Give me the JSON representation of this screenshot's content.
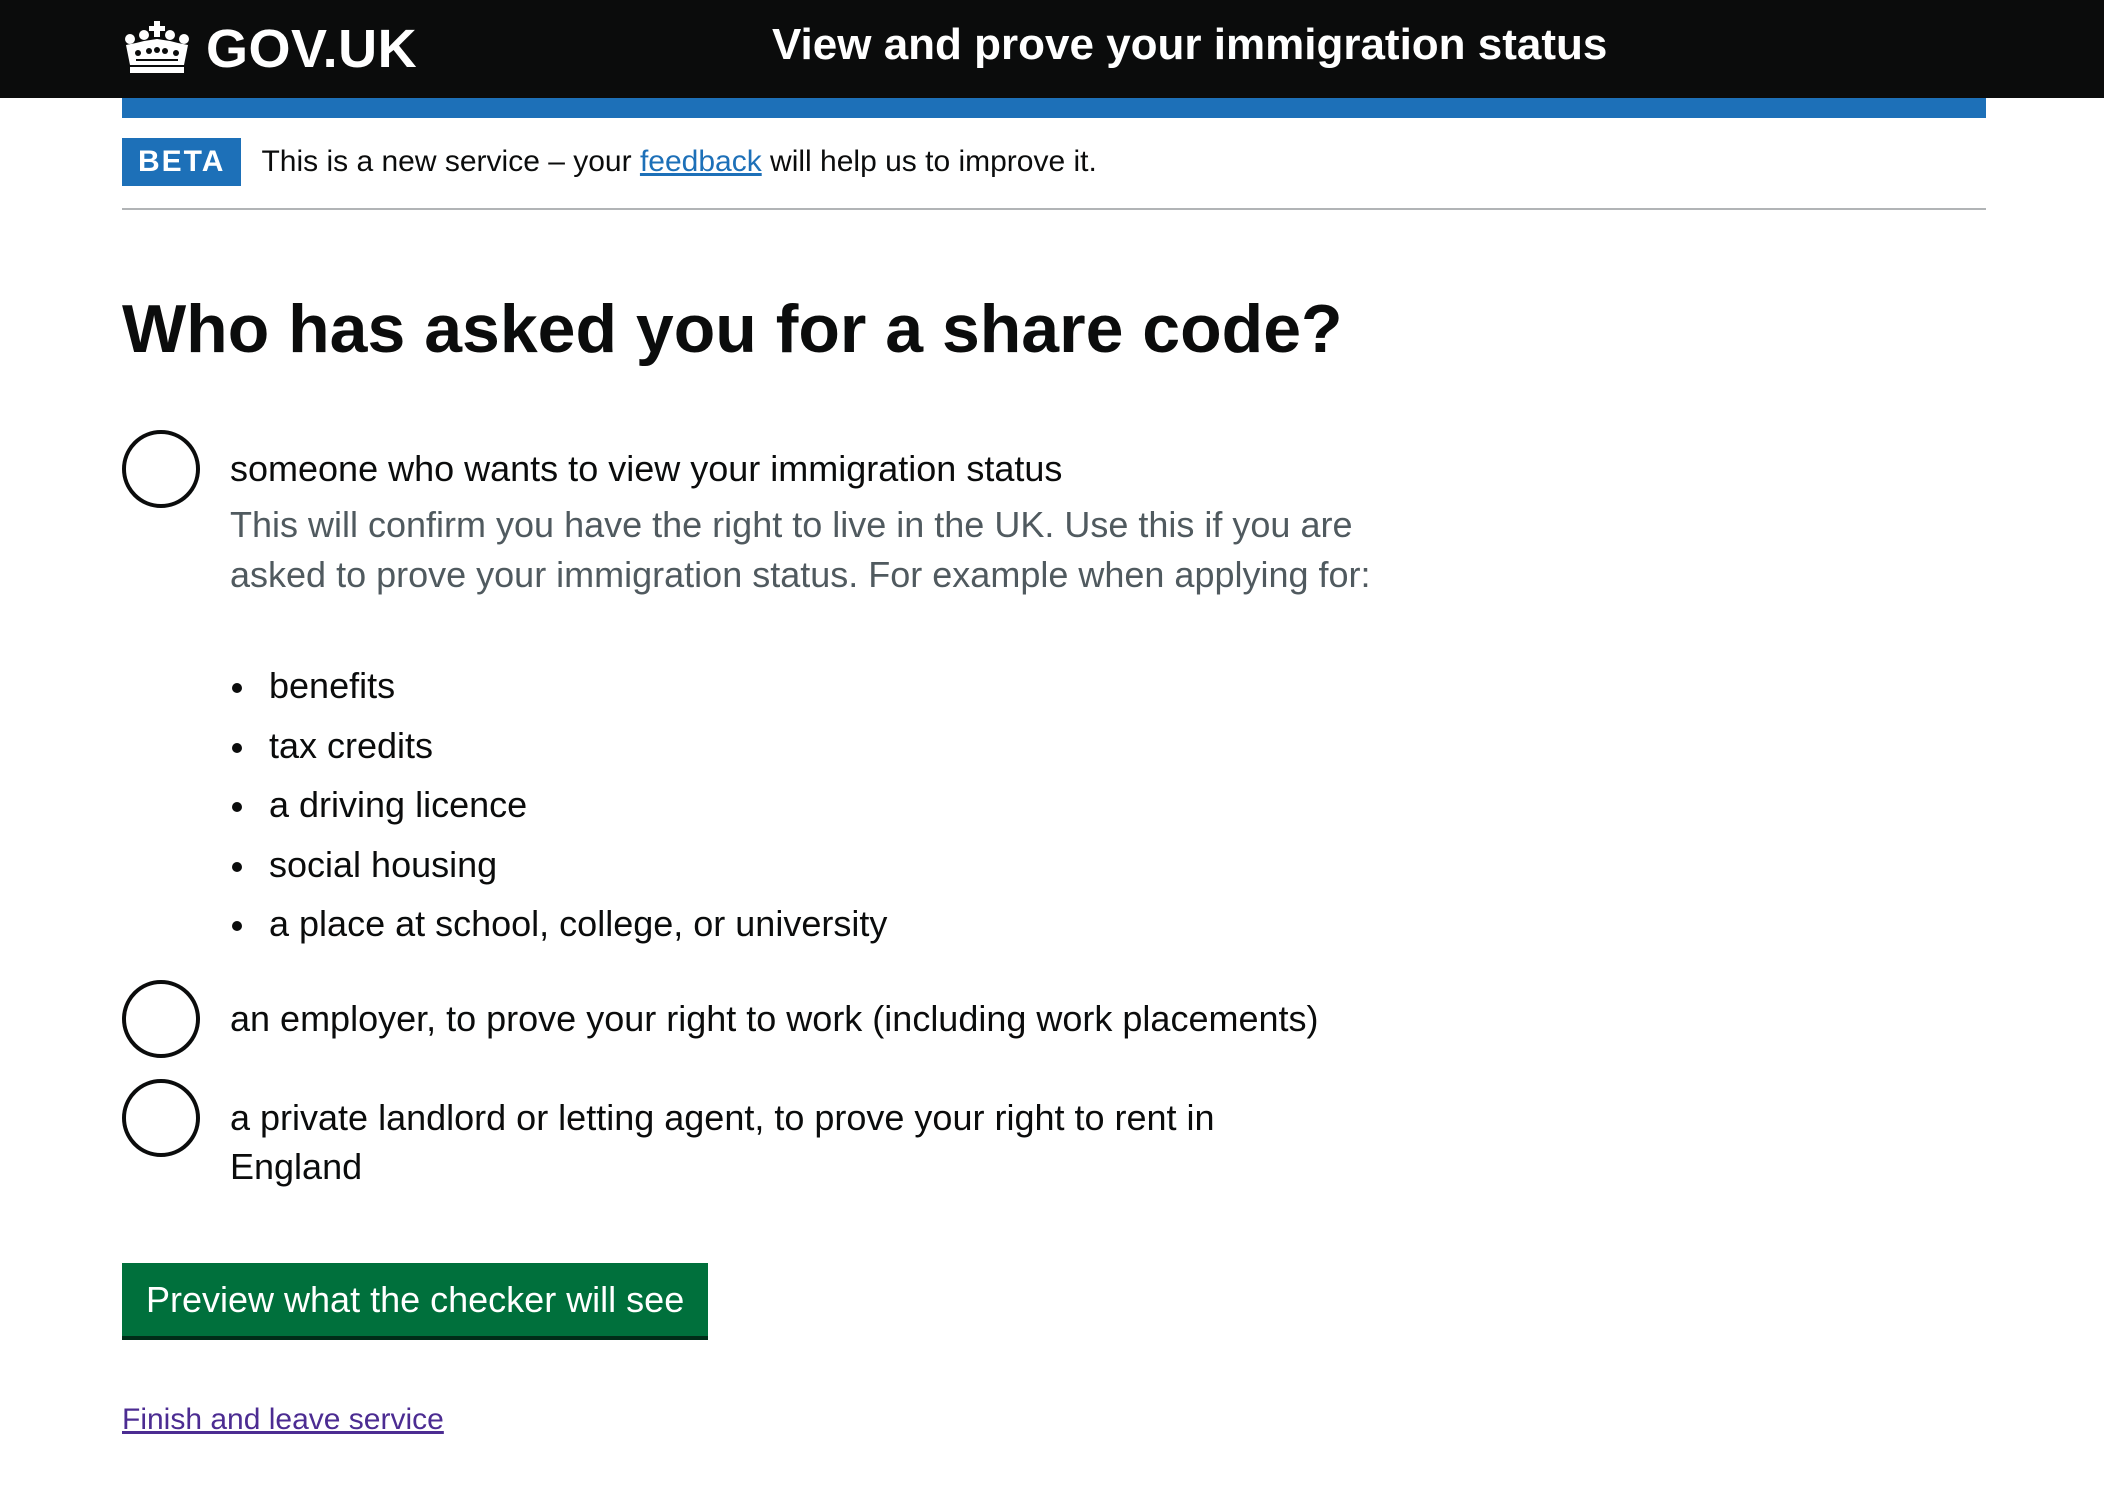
{
  "header": {
    "logo_text": "GOV.UK",
    "service_name": "View and prove your immigration status",
    "logo_icon": "crown-icon",
    "colors": {
      "header_bg": "#0b0c0c",
      "accent_bar": "#1d70b8"
    }
  },
  "phase_banner": {
    "tag": "BETA",
    "text_before": "This is a new service – your ",
    "link_text": "feedback",
    "text_after": " will help us to improve it."
  },
  "main": {
    "title": "Who has asked you for a share code?",
    "options": [
      {
        "label": "someone who wants to view your immigration status",
        "hint": "This will confirm you have the right to live in the UK. Use this if you are asked to prove your immigration status. For example when applying for:",
        "hint_items": [
          "benefits",
          "tax credits",
          "a driving licence",
          "social housing",
          "a place at school, college, or university"
        ],
        "selected": false
      },
      {
        "label": "an employer, to prove your right to work (including work placements)",
        "selected": false
      },
      {
        "label": "a private landlord or letting agent, to prove your right to rent in England",
        "selected": false
      }
    ],
    "primary_button": "Preview what the checker will see",
    "finish_link": "Finish and leave service",
    "colors": {
      "button": "#00703c",
      "link": "#1d70b8",
      "visited_link": "#4c2c92",
      "hint_text": "#505a5f"
    }
  }
}
